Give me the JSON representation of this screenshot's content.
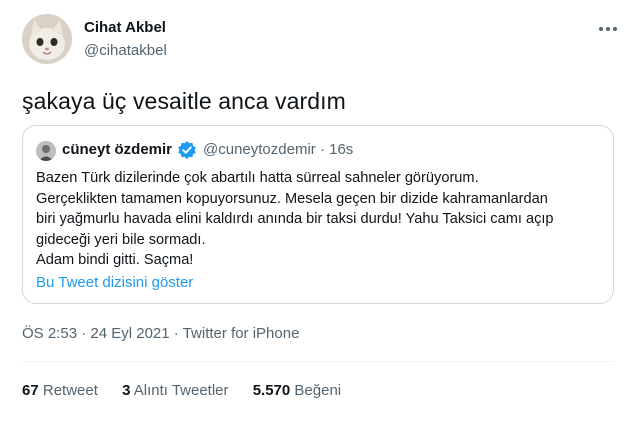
{
  "author": {
    "name": "Cihat Akbel",
    "handle": "@cihatakbel"
  },
  "tweet": {
    "text": "şakaya üç vesaitle anca vardım"
  },
  "quoted": {
    "name": "cüneyt özdemir",
    "handle": "@cuneytozdemir",
    "separator": "·",
    "time": "16s",
    "lines": [
      "Bazen Türk dizilerinde çok abartılı hatta sürreal sahneler görüyorum.",
      "Gerçeklikten tamamen kopuyorsunuz. Mesela geçen bir dizide kahramanlardan",
      "biri yağmurlu havada elini kaldırdı anında bir taksi durdu! Yahu Taksici camı açıp",
      "gideceği yeri bile sormadı.",
      "Adam bindi gitti. Saçma!"
    ],
    "thread_link": "Bu Tweet dizisini göster"
  },
  "meta": {
    "time": "ÖS 2:53",
    "separator": "·",
    "date": "24 Eyl 2021",
    "source": "Twitter for iPhone"
  },
  "stats": {
    "retweets_count": "67",
    "retweets_label": "Retweet",
    "quotes_count": "3",
    "quotes_label": "Alıntı Tweetler",
    "likes_count": "5.570",
    "likes_label": "Beğeni"
  },
  "icons": {
    "more": "more-horizontal-icon",
    "verified": "verified-badge-icon"
  },
  "colors": {
    "link": "#1d9bf0",
    "secondary": "#536471",
    "text": "#0f1419",
    "border": "#cfd9de"
  }
}
